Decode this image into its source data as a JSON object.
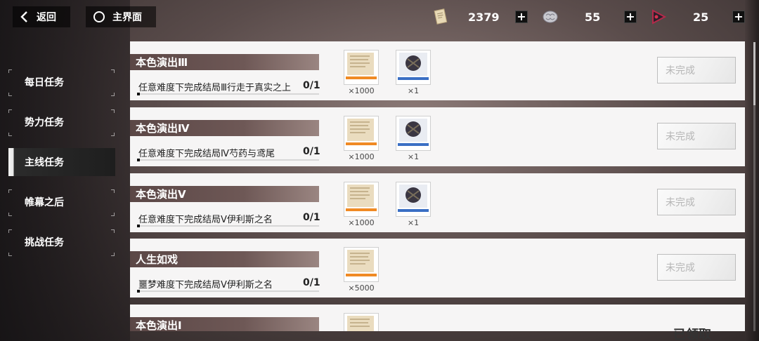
{
  "topbar": {
    "back_label": "返回",
    "home_label": "主界面",
    "resources": [
      {
        "icon": "document-icon",
        "value": "2379"
      },
      {
        "icon": "brain-icon",
        "value": "55"
      },
      {
        "icon": "triangle-emblem-icon",
        "value": "25"
      }
    ]
  },
  "nav": {
    "items": [
      {
        "label": "每日任务",
        "active": false
      },
      {
        "label": "势力任务",
        "active": false
      },
      {
        "label": "主线任务",
        "active": true
      },
      {
        "label": "帷幕之后",
        "active": false
      },
      {
        "label": "挑战任务",
        "active": false
      }
    ]
  },
  "quests": [
    {
      "title": "本色演出Ⅲ",
      "desc": "任意难度下完成结局Ⅲ行走于真实之上",
      "progress": "0/1",
      "progress_fraction": 0,
      "rewards": [
        {
          "kind": "paper",
          "count": "×1000"
        },
        {
          "kind": "supply",
          "count": "×1"
        }
      ],
      "status": "未完成"
    },
    {
      "title": "本色演出Ⅳ",
      "desc": "任意难度下完成结局Ⅳ芍药与鸢尾",
      "progress": "0/1",
      "progress_fraction": 0,
      "rewards": [
        {
          "kind": "paper",
          "count": "×1000"
        },
        {
          "kind": "supply",
          "count": "×1"
        }
      ],
      "status": "未完成"
    },
    {
      "title": "本色演出Ⅴ",
      "desc": "任意难度下完成结局Ⅴ伊利斯之名",
      "progress": "0/1",
      "progress_fraction": 0,
      "rewards": [
        {
          "kind": "paper",
          "count": "×1000"
        },
        {
          "kind": "supply",
          "count": "×1"
        }
      ],
      "status": "未完成"
    },
    {
      "title": "人生如戏",
      "desc": "噩梦难度下完成结局Ⅴ伊利斯之名",
      "progress": "0/1",
      "progress_fraction": 0,
      "rewards": [
        {
          "kind": "paper",
          "count": "×5000"
        }
      ],
      "status": "未完成"
    },
    {
      "title": "本色演出Ⅰ",
      "status": "已领取"
    }
  ],
  "colors": {
    "card_bg": "#f6f5f5",
    "title_bar": "#5b4746",
    "paper_accent": "#f08a24",
    "supply_accent": "#3a6fc4",
    "status_text": "#b6b6b6"
  }
}
